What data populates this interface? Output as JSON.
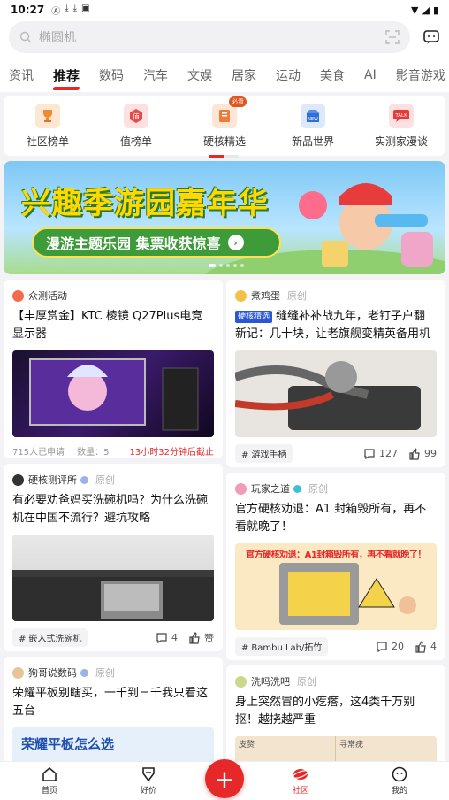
{
  "status": {
    "time": "10:27"
  },
  "search": {
    "placeholder": "椭圆机"
  },
  "tabs": [
    "资讯",
    "推荐",
    "数码",
    "汽车",
    "文娱",
    "居家",
    "运动",
    "美食",
    "AI",
    "影音游戏"
  ],
  "active_tab": "推荐",
  "quick": [
    {
      "label": "社区榜单",
      "icon": "trophy-icon",
      "color": "#f08a2e"
    },
    {
      "label": "值榜单",
      "icon": "value-badge-icon",
      "color": "#e84a4a"
    },
    {
      "label": "硬核精选",
      "icon": "book-icon",
      "color": "#f07a3a",
      "badge": "必看"
    },
    {
      "label": "新品世界",
      "icon": "new-box-icon",
      "color": "#2f6fd8"
    },
    {
      "label": "实测家漫谈",
      "icon": "talk-icon",
      "color": "#e8383a"
    }
  ],
  "banner": {
    "title": "兴趣季游园嘉年华",
    "subtitle": "漫游主题乐园 集票收获惊喜",
    "go": "›"
  },
  "cards": {
    "c1": {
      "author": "众测活动",
      "title": "【丰厚赏金】KTC 棱镜 Q27Plus电竞显示器",
      "applied": "715人已申请",
      "count": "数量：5",
      "deadline": "13小时32分钟后截止"
    },
    "c2": {
      "author": "煮鸡蛋",
      "original": "原创",
      "tag": "硬核精选",
      "title": "缝缝补补战九年，老钉子户翻新记：几十块，让老旗舰变精英备用机",
      "chip": "游戏手柄",
      "comments": "127",
      "likes": "99"
    },
    "c3": {
      "author": "硬核测评所",
      "original": "原创",
      "title": "有必要劝爸妈买洗碗机吗？为什么洗碗机在中国不流行？避坑攻略",
      "chip": "嵌入式洗碗机",
      "comments": "4",
      "likes": "赞"
    },
    "c4": {
      "author": "玩家之道",
      "original": "原创",
      "title": "官方硬核劝退：A1 封箱毁所有，再不看就晚了！",
      "img_text": "官方硬核劝退：A1封箱毁所有，再不看就晚了！",
      "chip": "Bambu Lab/拓竹",
      "comments": "20",
      "likes": "4"
    },
    "c5": {
      "author": "狗哥说数码",
      "original": "原创",
      "title": "荣耀平板别瞎买，一千到三千我只看这五台",
      "img_text": "荣耀平板怎么选"
    },
    "c6": {
      "author": "洗吗洗吧",
      "original": "原创",
      "title": "身上突然冒的小疙瘩，这4类千万别抠！越挠越严重",
      "img_left": "皮赘",
      "img_right": "寻常疣"
    }
  },
  "nav": [
    {
      "label": "首页",
      "icon": "home-icon"
    },
    {
      "label": "好价",
      "icon": "price-tag-icon"
    },
    {
      "label": "社区",
      "icon": "community-icon"
    },
    {
      "label": "我的",
      "icon": "profile-icon"
    }
  ],
  "colors": {
    "accent": "#e62828",
    "badge_blue": "#2b56d8"
  }
}
